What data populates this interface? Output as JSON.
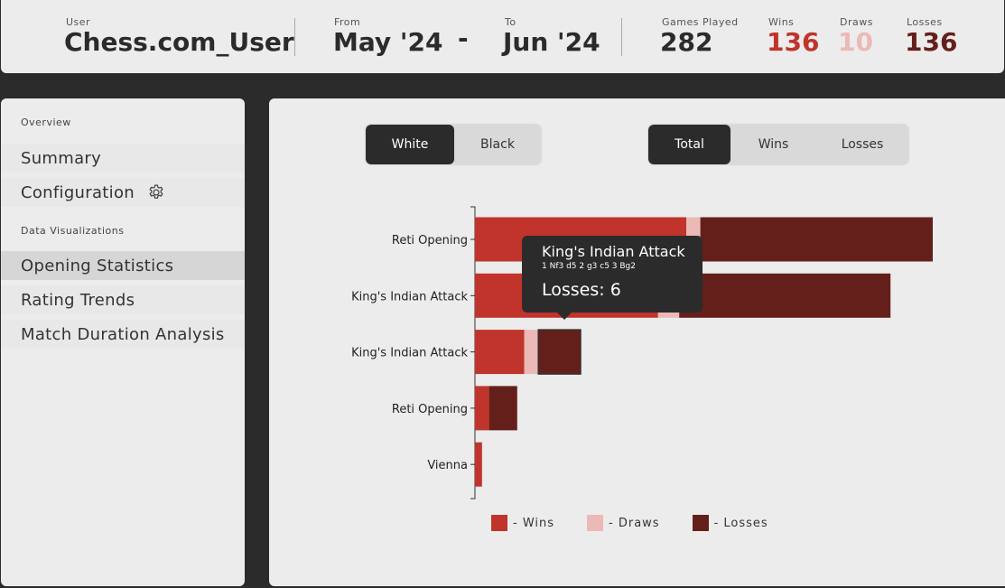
{
  "header": {
    "user_label": "User",
    "user_value": "Chess.com_User",
    "from_label": "From",
    "from_value": "May '24",
    "range_sep": "-",
    "to_label": "To",
    "to_value": "Jun '24",
    "games_label": "Games Played",
    "games_value": "282",
    "wins_label": "Wins",
    "wins_value": "136",
    "draws_label": "Draws",
    "draws_value": "10",
    "losses_label": "Losses",
    "losses_value": "136"
  },
  "colors": {
    "wins": "#c0342b",
    "draws": "#ebb9b6",
    "losses": "#651f1a",
    "dark": "#2b2b2b"
  },
  "sidebar": {
    "overview_label": "Overview",
    "summary": "Summary",
    "configuration": "Configuration",
    "dataviz_label": "Data Visualizations",
    "opening_statistics": "Opening Statistics",
    "rating_trends": "Rating Trends",
    "match_duration": "Match Duration Analysis"
  },
  "controls": {
    "side_options": [
      "White",
      "Black"
    ],
    "side_selected": "White",
    "metric_options": [
      "Total",
      "Wins",
      "Losses"
    ],
    "metric_selected": "Total"
  },
  "tooltip": {
    "title": "King's Indian Attack",
    "moves": "1 Nf3 d5 2 g3 c5 3 Bg2",
    "value_text": "Losses: 6"
  },
  "chart_data": {
    "type": "bar",
    "orientation": "horizontal",
    "stacked": true,
    "categories": [
      "Reti Opening",
      "King's Indian Attack",
      "King's Indian Attack",
      "Reti Opening",
      "Vienna"
    ],
    "series": [
      {
        "name": "Wins",
        "values": [
          15,
          13,
          3.5,
          1,
          0.5
        ]
      },
      {
        "name": "Draws",
        "values": [
          1,
          1.5,
          1,
          0,
          0
        ]
      },
      {
        "name": "Losses",
        "values": [
          16.5,
          15,
          3,
          2,
          0
        ]
      }
    ],
    "legend": [
      "- Wins",
      "- Draws",
      "- Losses"
    ],
    "legend_position": "bottom",
    "grid": false
  }
}
